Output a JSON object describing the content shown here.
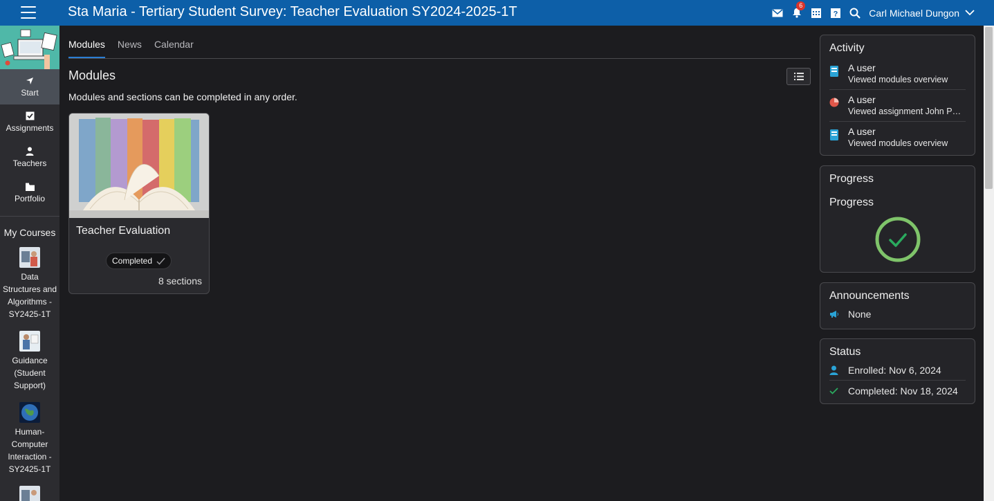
{
  "header": {
    "title": "Sta Maria - Tertiary Student Survey: Teacher Evaluation SY2024-2025-1T",
    "notification_count": "6",
    "user_name": "Carl Michael Dungon",
    "icons": [
      "mail-icon",
      "bell-icon",
      "calendar-icon",
      "help-icon",
      "search-icon"
    ]
  },
  "sidebar": {
    "items": [
      {
        "label": "Start",
        "icon": "navigate-icon",
        "active": true
      },
      {
        "label": "Assignments",
        "icon": "checkbox-icon"
      },
      {
        "label": "Teachers",
        "icon": "person-icon"
      },
      {
        "label": "Portfolio",
        "icon": "folder-icon"
      }
    ],
    "my_courses_label": "My Courses",
    "courses": [
      {
        "name": "Data Structures and Algorithms - SY2425-1T"
      },
      {
        "name": "Guidance (Student Support)"
      },
      {
        "name": "Human-Computer Interaction - SY2425-1T"
      }
    ]
  },
  "main": {
    "tabs": [
      {
        "label": "Modules",
        "active": true
      },
      {
        "label": "News"
      },
      {
        "label": "Calendar"
      }
    ],
    "heading": "Modules",
    "subtext": "Modules and sections can be completed in any order.",
    "card": {
      "title": "Teacher Evaluation",
      "status": "Completed",
      "sections": "8 sections"
    }
  },
  "activity": {
    "title": "Activity",
    "items": [
      {
        "who": "A user",
        "what": "Viewed modules overview",
        "icon": "module-icon"
      },
      {
        "who": "A user",
        "what": "Viewed assignment John Paul ...",
        "icon": "assignment-icon"
      },
      {
        "who": "A user",
        "what": "Viewed modules overview",
        "icon": "module-icon"
      }
    ]
  },
  "progress": {
    "title": "Progress",
    "subtitle": "Progress",
    "value": 1.0
  },
  "announcements": {
    "title": "Announcements",
    "text": "None"
  },
  "status": {
    "title": "Status",
    "enrolled": "Enrolled: Nov 6, 2024",
    "completed": "Completed: Nov 18, 2024"
  },
  "colors": {
    "topbar": "#0d5fa8",
    "accent": "#2b7ed4",
    "success": "#4caf50",
    "logo_bg": "#4fb8a8"
  }
}
